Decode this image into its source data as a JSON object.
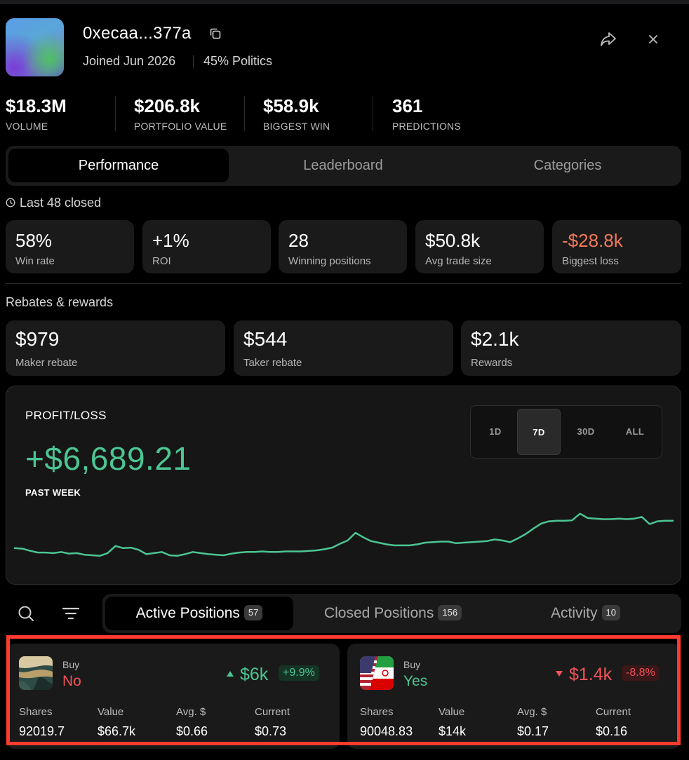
{
  "profile": {
    "username": "0xecaa...377a",
    "joined": "Joined Jun 2026",
    "top_category": "45% Politics"
  },
  "stats": [
    {
      "value": "$18.3M",
      "label": "VOLUME"
    },
    {
      "value": "$206.8k",
      "label": "PORTFOLIO VALUE"
    },
    {
      "value": "$58.9k",
      "label": "BIGGEST WIN"
    },
    {
      "value": "361",
      "label": "PREDICTIONS"
    }
  ],
  "tabs": [
    "Performance",
    "Leaderboard",
    "Categories"
  ],
  "closed_label": "Last 48 closed",
  "performance": [
    {
      "value": "58%",
      "label": "Win rate"
    },
    {
      "value": "+1%",
      "label": "ROI"
    },
    {
      "value": "28",
      "label": "Winning positions"
    },
    {
      "value": "$50.8k",
      "label": "Avg trade size"
    },
    {
      "value": "-$28.8k",
      "label": "Biggest loss"
    }
  ],
  "rebates_title": "Rebates & rewards",
  "rebates": [
    {
      "value": "$979",
      "label": "Maker rebate"
    },
    {
      "value": "$544",
      "label": "Taker rebate"
    },
    {
      "value": "$2.1k",
      "label": "Rewards"
    }
  ],
  "pnl": {
    "title": "PROFIT/LOSS",
    "value": "+$6,689.21",
    "period": "PAST WEEK",
    "ranges": [
      "1D",
      "7D",
      "30D",
      "ALL"
    ],
    "active_range": "7D",
    "line_color": "#4cc593",
    "series": [
      0.22,
      0.21,
      0.17,
      0.14,
      0.14,
      0.13,
      0.15,
      0.12,
      0.13,
      0.1,
      0.09,
      0.08,
      0.13,
      0.26,
      0.22,
      0.23,
      0.19,
      0.11,
      0.13,
      0.15,
      0.09,
      0.08,
      0.11,
      0.15,
      0.13,
      0.11,
      0.1,
      0.09,
      0.12,
      0.14,
      0.15,
      0.15,
      0.16,
      0.15,
      0.15,
      0.16,
      0.16,
      0.16,
      0.17,
      0.18,
      0.2,
      0.23,
      0.3,
      0.36,
      0.5,
      0.42,
      0.35,
      0.32,
      0.29,
      0.27,
      0.27,
      0.27,
      0.29,
      0.32,
      0.33,
      0.34,
      0.34,
      0.31,
      0.32,
      0.33,
      0.34,
      0.35,
      0.38,
      0.36,
      0.33,
      0.4,
      0.48,
      0.58,
      0.67,
      0.71,
      0.72,
      0.72,
      0.73,
      0.85,
      0.77,
      0.76,
      0.75,
      0.75,
      0.76,
      0.75,
      0.76,
      0.79,
      0.66,
      0.71,
      0.72,
      0.72
    ]
  },
  "positions_tabs": [
    {
      "label": "Active Positions",
      "count": "57"
    },
    {
      "label": "Closed Positions",
      "count": "156"
    },
    {
      "label": "Activity",
      "count": "10"
    }
  ],
  "positions": [
    {
      "side": "Buy",
      "outcome": "No",
      "outcome_color": "#f0545a",
      "pl": "$6k",
      "pl_pct": "+9.9%",
      "direction": "up",
      "thumb": "landscape",
      "columns": [
        {
          "label": "Shares",
          "value": "92019.7"
        },
        {
          "label": "Value",
          "value": "$66.7k"
        },
        {
          "label": "Avg. $",
          "value": "$0.66"
        },
        {
          "label": "Current",
          "value": "$0.73"
        }
      ]
    },
    {
      "side": "Buy",
      "outcome": "Yes",
      "outcome_color": "#4cc593",
      "pl": "$1.4k",
      "pl_pct": "-8.8%",
      "direction": "down",
      "thumb": "flags",
      "columns": [
        {
          "label": "Shares",
          "value": "90048.83"
        },
        {
          "label": "Value",
          "value": "$14k"
        },
        {
          "label": "Avg. $",
          "value": "$0.17"
        },
        {
          "label": "Current",
          "value": "$0.16"
        }
      ]
    }
  ]
}
